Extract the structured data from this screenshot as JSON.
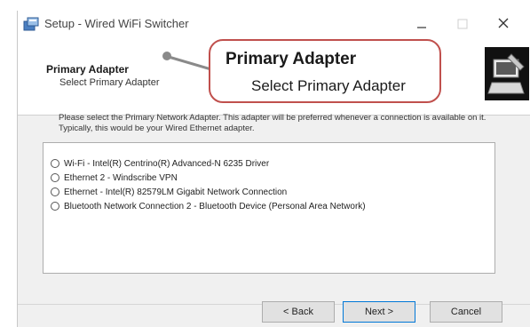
{
  "window": {
    "title": "Setup - Wired WiFi Switcher",
    "controls": [
      "minimize",
      "maximize",
      "close"
    ]
  },
  "header": {
    "title": "Primary Adapter",
    "subtitle": "Select Primary Adapter"
  },
  "callout": {
    "title": "Primary Adapter",
    "subtitle": "Select Primary Adapter",
    "border_color": "#c0504d"
  },
  "description": "Please select the Primary Network Adapter. This adapter will be preferred whenever a connection is available on it. Typically, this would be your Wired Ethernet adapter.",
  "adapters": [
    "Wi-Fi - Intel(R) Centrino(R) Advanced-N 6235 Driver",
    "Ethernet 2 - Windscribe VPN",
    "Ethernet - Intel(R) 82579LM Gigabit Network Connection",
    "Bluetooth Network Connection 2 - Bluetooth Device (Personal Area Network)"
  ],
  "buttons": {
    "back": "< Back",
    "next": "Next >",
    "cancel": "Cancel"
  },
  "icons": {
    "app": "setup-package-icon",
    "wizard": "wizard-computer-icon",
    "minimize": "minimize-icon",
    "maximize": "maximize-icon",
    "close": "close-icon"
  }
}
